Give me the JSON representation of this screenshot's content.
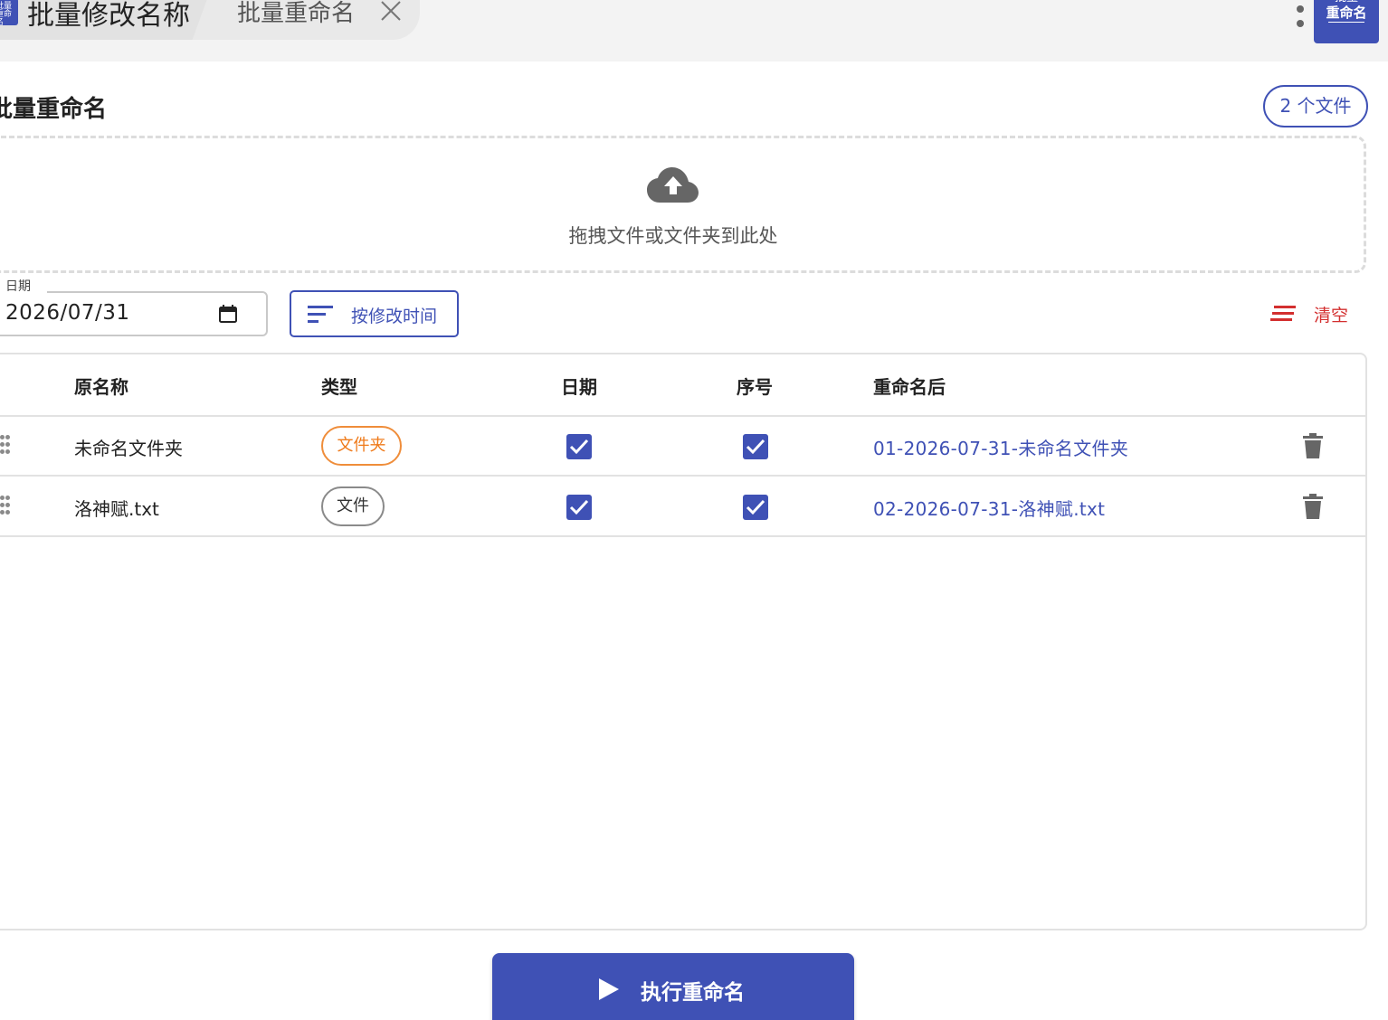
{
  "tabs": [
    {
      "title": "批量修改名称",
      "logo_text": "批量重命名",
      "active": true
    },
    {
      "title": "批量重命名",
      "active": false
    }
  ],
  "app_logo": {
    "line1": "批量",
    "line2": "重命名"
  },
  "page": {
    "title": "批量重命名",
    "file_count": "2 个文件"
  },
  "dropzone": {
    "text": "拖拽文件或文件夹到此处"
  },
  "date_field": {
    "label": "日期",
    "value": "2026/07/31"
  },
  "sort_button": {
    "label": "按修改时间"
  },
  "clear_button": {
    "label": "清空"
  },
  "table": {
    "headers": {
      "name": "原名称",
      "type": "类型",
      "date": "日期",
      "seq": "序号",
      "renamed": "重命名后"
    },
    "rows": [
      {
        "name": "未命名文件夹",
        "type": "文件夹",
        "date_checked": true,
        "seq_checked": true,
        "renamed": "01-2026-07-31-未命名文件夹"
      },
      {
        "name": "洛神赋.txt",
        "type": "文件",
        "date_checked": true,
        "seq_checked": true,
        "renamed": "02-2026-07-31-洛神赋.txt"
      }
    ]
  },
  "run_button": {
    "label": "执行重命名"
  },
  "colors": {
    "primary": "#3f51b5",
    "danger": "#d32f2f",
    "folder_chip": "#ef7a1a"
  }
}
